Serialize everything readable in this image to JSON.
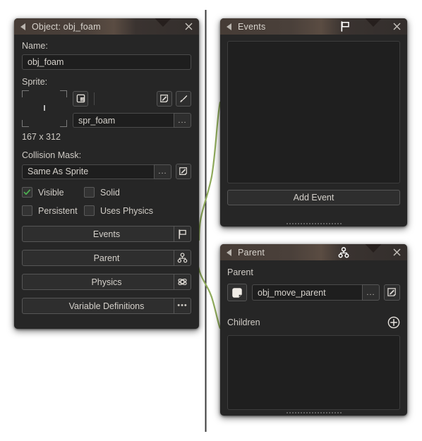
{
  "theme": {
    "page_bg": "#ffffff",
    "panel_bg": "#262626",
    "panel_border": "#3d3d3d",
    "titlebar_accent": "#5a4c42",
    "text": "#d4d0ca",
    "input_bg": "#1e1e1e",
    "check_green": "#4caf50",
    "connector_green": "#8fab5c",
    "separator": "#555555"
  },
  "object_panel": {
    "title": "Object: obj_foam",
    "collapse_icon": "triangle-left-icon",
    "close_icon": "close-icon",
    "name": {
      "label": "Name:",
      "value": "obj_foam"
    },
    "sprite": {
      "label": "Sprite:",
      "preview_icon": "sprite-preview-frame",
      "add_sprite_icon": "add-sprite-icon",
      "edit_image_icon": "edit-image-icon",
      "paint_icon": "paintbrush-icon",
      "value": "spr_foam",
      "menu_label": "...",
      "dimensions": "167 x 312"
    },
    "collision_mask": {
      "label": "Collision Mask:",
      "value": "Same As Sprite",
      "menu_label": "...",
      "edit_icon": "edit-mask-icon"
    },
    "checkboxes": [
      {
        "label": "Visible",
        "checked": true
      },
      {
        "label": "Solid",
        "checked": false
      },
      {
        "label": "Persistent",
        "checked": false
      },
      {
        "label": "Uses Physics",
        "checked": false
      }
    ],
    "buttons": [
      {
        "label": "Events",
        "icon": "flag-icon"
      },
      {
        "label": "Parent",
        "icon": "parent-nodes-icon"
      },
      {
        "label": "Physics",
        "icon": "physics-atom-icon"
      },
      {
        "label": "Variable Definitions",
        "icon": "ellipsis-icon"
      }
    ]
  },
  "events_panel": {
    "title": "Events",
    "collapse_icon": "triangle-left-icon",
    "header_icon": "flag-icon",
    "close_icon": "close-icon",
    "list_items": [],
    "add_event_label": "Add Event",
    "resize_grip": "resize-grip"
  },
  "parent_panel": {
    "title": "Parent",
    "collapse_icon": "triangle-left-icon",
    "header_icon": "parent-nodes-icon",
    "close_icon": "close-icon",
    "parent_section_label": "Parent",
    "parent_object_icon": "object-icon",
    "parent_value": "obj_move_parent",
    "parent_menu_label": "...",
    "parent_edit_icon": "edit-object-icon",
    "children_section_label": "Children",
    "children_add_icon": "add-circle-icon",
    "children_items": [],
    "resize_grip": "resize-grip"
  },
  "connectors": {
    "separator_name": "vertical-separator-line",
    "link_events": "object-to-events-link",
    "link_parent": "object-to-parent-link"
  }
}
